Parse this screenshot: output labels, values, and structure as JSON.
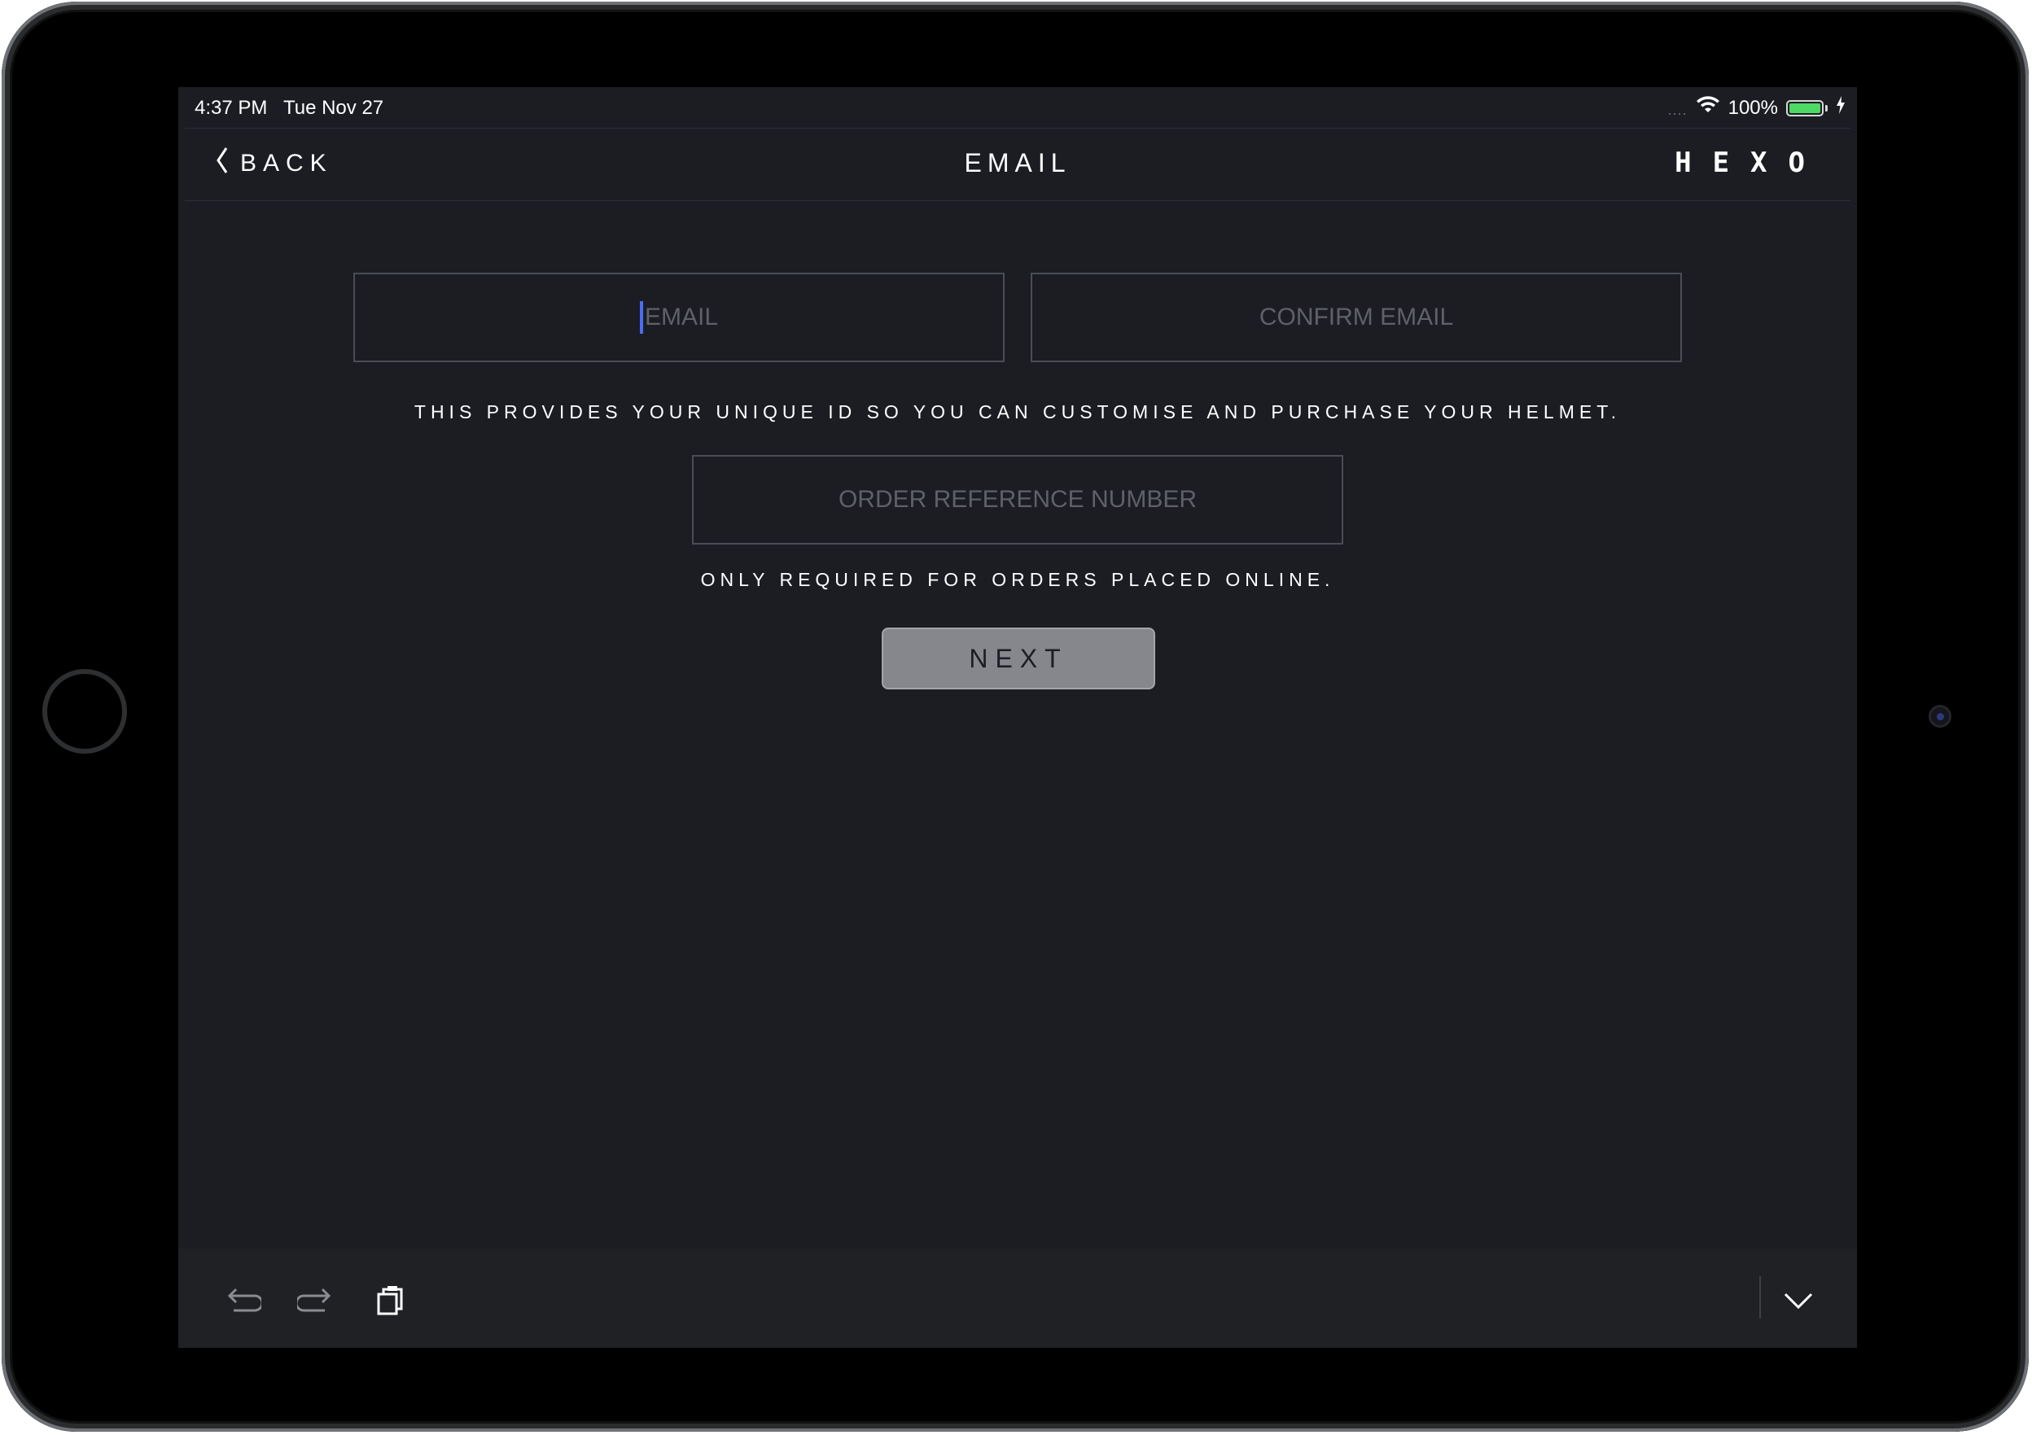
{
  "status_bar": {
    "time": "4:37 PM",
    "date": "Tue Nov 27",
    "signal": "....",
    "battery_percent": "100%",
    "battery_level": 1.0,
    "battery_color": "#4cd964"
  },
  "nav": {
    "back_label": "BACK",
    "title": "EMAIL",
    "brand": "HEXO"
  },
  "form": {
    "email_placeholder": "EMAIL",
    "confirm_email_placeholder": "CONFIRM EMAIL",
    "email_helper": "THIS PROVIDES YOUR UNIQUE ID SO YOU CAN CUSTOMISE AND PURCHASE YOUR HELMET.",
    "order_ref_placeholder": "ORDER REFERENCE NUMBER",
    "order_helper": "ONLY REQUIRED FOR ORDERS PLACED ONLINE.",
    "next_label": "NEXT"
  },
  "keyboard_bar": {
    "undo_icon": "undo-icon",
    "redo_icon": "redo-icon",
    "paste_icon": "paste-icon",
    "dismiss_icon": "chevron-down-icon"
  },
  "colors": {
    "background": "#1b1d23",
    "caret": "#4a6cf7",
    "next_button": "#85878c"
  }
}
